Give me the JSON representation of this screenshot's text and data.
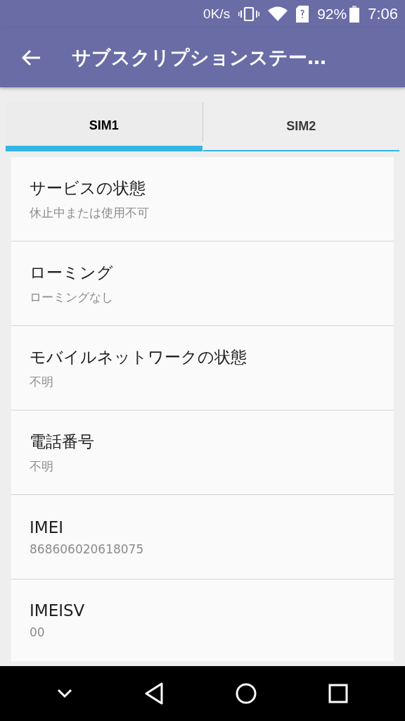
{
  "status_bar": {
    "speed": "0K/s",
    "battery_text": "92%",
    "time": "7:06"
  },
  "app_bar": {
    "title": "サブスクリプションステー…"
  },
  "tabs": [
    {
      "label": "SIM1",
      "selected": true
    },
    {
      "label": "SIM2",
      "selected": false
    }
  ],
  "items": [
    {
      "title": "サービスの状態",
      "value": "休止中または使用不可"
    },
    {
      "title": "ローミング",
      "value": "ローミングなし"
    },
    {
      "title": "モバイルネットワークの状態",
      "value": "不明"
    },
    {
      "title": "電話番号",
      "value": "不明"
    },
    {
      "title": "IMEI",
      "value": "868606020618075"
    },
    {
      "title": "IMEISV",
      "value": "00"
    }
  ]
}
